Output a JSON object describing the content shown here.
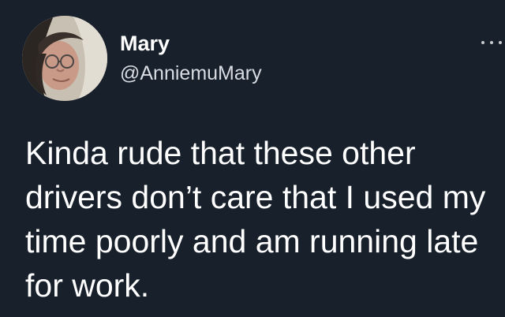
{
  "tweet": {
    "author": {
      "display_name": "Mary",
      "handle": "@AnniemuMary",
      "avatar_icon": "profile-photo"
    },
    "more_icon": "more-options-icon",
    "text": "Kinda rude that these other\ndrivers don’t care that I used my\ntime poorly and am running late\nfor work."
  },
  "theme": {
    "background": "#17202b",
    "text": "#ffffff",
    "secondary_text": "#d9dde3"
  }
}
